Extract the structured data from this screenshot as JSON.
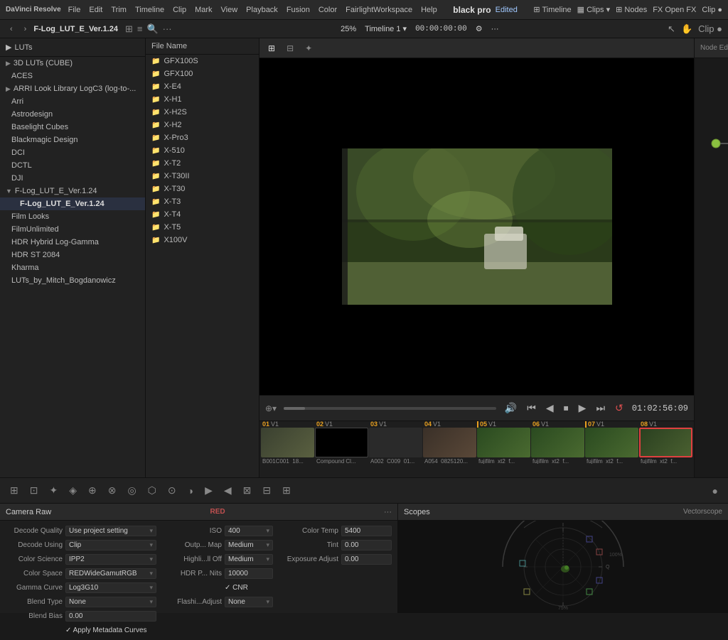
{
  "topbar": {
    "logo": "DaVinci Resolve",
    "menus": [
      "File",
      "Edit",
      "Trim",
      "Timeline",
      "Clip",
      "Mark",
      "View",
      "Playback",
      "Fusion",
      "Color",
      "FairlightWorkspace",
      "Help"
    ],
    "project_name": "black pro",
    "edited_label": "Edited",
    "right_items": [
      "Timeline",
      "Clips",
      "Nodes",
      "Open FX",
      "Clip"
    ]
  },
  "navbar": {
    "back_btn": "‹",
    "breadcrumb": "F-Log_LUT_E_Ver.1.24",
    "zoom_label": "25%",
    "timeline_label": "Timeline 1",
    "timecode": "00:00:00:00"
  },
  "sidebar": {
    "header": "LUTs",
    "items": [
      {
        "label": "LUTs",
        "level": 0,
        "arrow": "▶",
        "id": "luts-root"
      },
      {
        "label": "3D LUTs (CUBE)",
        "level": 1,
        "arrow": "▶",
        "id": "3d-luts"
      },
      {
        "label": "ACES",
        "level": 1,
        "id": "aces"
      },
      {
        "label": "ARRI Look Library LogC3 (log-to-...",
        "level": 1,
        "arrow": "▶",
        "id": "arri-look"
      },
      {
        "label": "Arri",
        "level": 1,
        "id": "arri"
      },
      {
        "label": "Astrodesign",
        "level": 1,
        "id": "astrodesign"
      },
      {
        "label": "Baselight Cubes",
        "level": 1,
        "id": "baselight"
      },
      {
        "label": "Blackmagic Design",
        "level": 1,
        "id": "blackmagic"
      },
      {
        "label": "DCI",
        "level": 1,
        "id": "dci"
      },
      {
        "label": "DCTL",
        "level": 1,
        "id": "dctl"
      },
      {
        "label": "DJI",
        "level": 1,
        "id": "dji"
      },
      {
        "label": "F-Log_LUT_E_Ver.1.24",
        "level": 1,
        "arrow": "▼",
        "id": "flog-parent"
      },
      {
        "label": "F-Log_LUT_E_Ver.1.24",
        "level": 2,
        "active": true,
        "id": "flog-active"
      },
      {
        "label": "Film Looks",
        "level": 1,
        "id": "film-looks"
      },
      {
        "label": "FilmUnlimited",
        "level": 1,
        "id": "filmunlimited"
      },
      {
        "label": "HDR Hybrid Log-Gamma",
        "level": 1,
        "id": "hdr-hybrid"
      },
      {
        "label": "HDR ST 2084",
        "level": 1,
        "id": "hdr-st"
      },
      {
        "label": "Kharma",
        "level": 1,
        "id": "kharma"
      },
      {
        "label": "LUTs_by_Mitch_Bogdanowicz",
        "level": 1,
        "id": "luts-mitch"
      }
    ]
  },
  "file_browser": {
    "header": "File Name",
    "items": [
      "GFX100S",
      "GFX100",
      "X-E4",
      "X-H1",
      "X-H2S",
      "X-H2",
      "X-Pro3",
      "X-510",
      "X-T2",
      "X-T30II",
      "X-T30",
      "X-T3",
      "X-T4",
      "X-T5",
      "X100V"
    ]
  },
  "preview": {
    "timecode": "01:02:56:09"
  },
  "timeline": {
    "clips": [
      {
        "num": "01",
        "track": "V1",
        "name": "B001C001_18...",
        "type": "color"
      },
      {
        "num": "02",
        "track": "V1",
        "name": "Compound Cl...",
        "type": "black"
      },
      {
        "num": "03",
        "track": "V1",
        "name": "A002_C009_01...",
        "type": "dark"
      },
      {
        "num": "04",
        "track": "V1",
        "name": "A054_0825120...",
        "type": "people"
      },
      {
        "num": "05",
        "track": "V1",
        "name": "fujifilm_xt2_f...",
        "type": "green"
      },
      {
        "num": "06",
        "track": "V1",
        "name": "fujifilm_xt2_f...",
        "type": "green"
      },
      {
        "num": "07",
        "track": "V1",
        "name": "fujifilm_xt2_f...",
        "type": "green"
      },
      {
        "num": "08",
        "track": "V1",
        "name": "fujifilm_xt2_f...",
        "type": "selected"
      }
    ]
  },
  "tools": {
    "icons": [
      "⊞",
      "⊡",
      "✦",
      "♦",
      "◈",
      "⊕",
      "⊗",
      "◎",
      "⊙",
      "⋮",
      "◑",
      "▶",
      "◀",
      "⊠",
      "⊟",
      "⊞",
      "●"
    ]
  },
  "camera_raw": {
    "title": "Camera Raw",
    "badge": "RED",
    "fields_left": [
      {
        "label": "Decode Quality",
        "value": "Use project setting",
        "dropdown": true
      },
      {
        "label": "Decode Using",
        "value": "Clip",
        "dropdown": true
      },
      {
        "label": "Color Science",
        "value": "IPP2",
        "dropdown": true
      },
      {
        "label": "Color Space",
        "value": "REDWideGamutRGB",
        "dropdown": true
      },
      {
        "label": "Gamma Curve",
        "value": "Log3G10",
        "dropdown": true
      },
      {
        "label": "Blend Type",
        "value": "None",
        "dropdown": true
      },
      {
        "label": "Blend Bias",
        "value": "0.00"
      },
      {
        "label": "",
        "value": "✓ Apply Metadata Curves"
      }
    ],
    "fields_middle": [
      {
        "label": "ISO",
        "value": "400",
        "dropdown": true
      },
      {
        "label": "Outp... Map",
        "value": "Medium",
        "dropdown": true
      },
      {
        "label": "Highli...ll Off",
        "value": "Medium",
        "dropdown": true
      },
      {
        "label": "HDR P... Nits",
        "value": "10000"
      },
      {
        "label": "",
        "value": "✓ CNR"
      },
      {
        "label": "Flashi...Adjust",
        "value": "None",
        "dropdown": true
      }
    ],
    "fields_right": [
      {
        "label": "Color Temp",
        "value": "5400"
      },
      {
        "label": "Tint",
        "value": "0.00"
      },
      {
        "label": "Exposure Adjust",
        "value": "0.00"
      }
    ]
  },
  "scopes": {
    "title": "Scopes",
    "type": "Vectorscope"
  }
}
